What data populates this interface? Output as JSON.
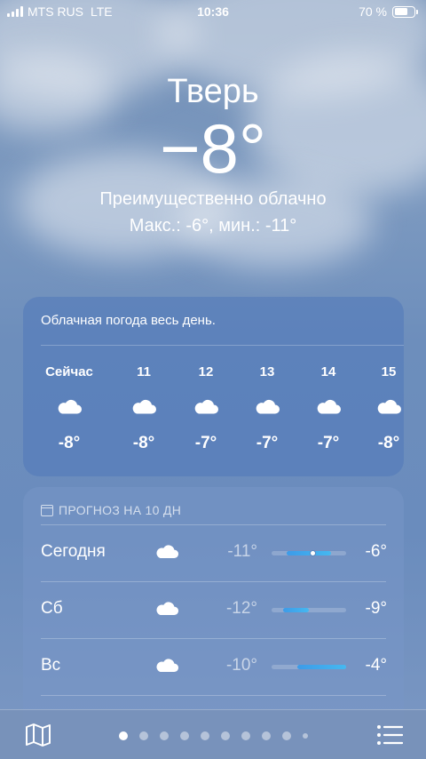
{
  "status": {
    "carrier": "MTS RUS",
    "network": "LTE",
    "time": "10:36",
    "battery_text": "70 %",
    "battery_level": 0.7
  },
  "current": {
    "city": "Тверь",
    "temperature": "−8°",
    "condition": "Преимущественно облачно",
    "hi_lo": "Макс.: -6°, мин.: -11°"
  },
  "hourly": {
    "summary": "Облачная погода весь день.",
    "hours": [
      {
        "label": "Сейчас",
        "icon": "cloud-icon",
        "temp": "-8°"
      },
      {
        "label": "11",
        "icon": "cloud-icon",
        "temp": "-8°"
      },
      {
        "label": "12",
        "icon": "cloud-icon",
        "temp": "-7°"
      },
      {
        "label": "13",
        "icon": "cloud-icon",
        "temp": "-7°"
      },
      {
        "label": "14",
        "icon": "cloud-icon",
        "temp": "-7°"
      },
      {
        "label": "15",
        "icon": "cloud-icon",
        "temp": "-8°"
      }
    ]
  },
  "daily": {
    "header": "ПРОГНОЗ НА 10 ДН",
    "days": [
      {
        "name": "Сегодня",
        "icon": "cloud-icon",
        "low": "-11°",
        "high": "-6°",
        "range_start": 0.2,
        "range_end": 0.8,
        "current_marker": 0.55
      },
      {
        "name": "Сб",
        "icon": "cloud-icon",
        "low": "-12°",
        "high": "-9°",
        "range_start": 0.15,
        "range_end": 0.5
      },
      {
        "name": "Вс",
        "icon": "cloud-icon",
        "low": "-10°",
        "high": "-4°",
        "range_start": 0.35,
        "range_end": 1.0
      }
    ]
  },
  "tabbar": {
    "page_count": 10,
    "active_page": 0,
    "map_icon": "map-icon",
    "list_icon": "list-icon"
  },
  "colors": {
    "card_bg": "#5078b9",
    "temp_bar": "#3d9be8"
  }
}
